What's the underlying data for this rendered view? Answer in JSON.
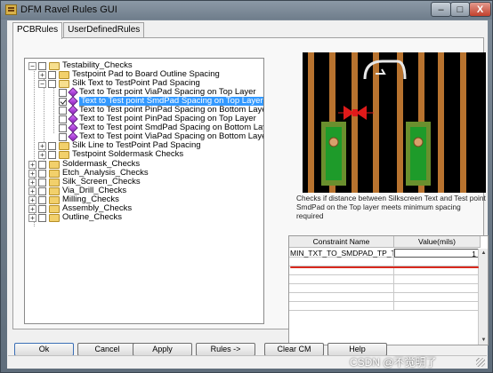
{
  "window": {
    "title": "DFM Ravel Rules GUI",
    "icon": "app-icon"
  },
  "tabs": [
    {
      "label": "PCBRules",
      "active": true
    },
    {
      "label": "UserDefinedRules",
      "active": false
    }
  ],
  "tree": {
    "testability": "Testability_Checks",
    "testpoint_pad_board": "Testpoint Pad to Board Outline Spacing",
    "silk_text_tp": "Silk Text to TestPoint Pad Spacing",
    "rules": [
      {
        "label": "Text to Test point ViaPad Spacing on Top Layer",
        "checked": false,
        "selected": false
      },
      {
        "label": "Text to Test point SmdPad Spacing on Top Layer",
        "checked": true,
        "selected": true
      },
      {
        "label": "Text to Test point PinPad Spacing on Bottom Layer",
        "checked": false,
        "selected": false
      },
      {
        "label": "Text to Test point PinPad Spacing on Top Layer",
        "checked": false,
        "selected": false
      },
      {
        "label": "Text to Test point SmdPad Spacing on Bottom Layer",
        "checked": false,
        "selected": false
      },
      {
        "label": "Text to Test point ViaPad Spacing on Bottom Layer",
        "checked": false,
        "selected": false
      }
    ],
    "silk_line_tp": "Silk Line to TestPoint Pad Spacing",
    "testpoint_soldermask": "Testpoint Soldermask Checks",
    "top_level": [
      "Soldermask_Checks",
      "Etch_Analysis_Checks",
      "Silk_Screen_Checks",
      "Via_Drill_Checks",
      "Milling_Checks",
      "Assembly_Checks",
      "Outline_Checks"
    ]
  },
  "description": "Checks if distance between Silkscreen Text and Test point SmdPad on the Top layer meets minimum spacing required",
  "constraints": {
    "headers": [
      "Constraint Name",
      "Value(mils)"
    ],
    "rows": [
      {
        "name": "MIN_TXT_TO_SMDPAD_TP_TOP_D",
        "value": "1"
      }
    ],
    "empty_rows": 8
  },
  "buttons": {
    "ok": "Ok",
    "cancel": "Cancel",
    "apply": "Apply",
    "rules": "Rules ->",
    "clear": "Clear CM",
    "help": "Help"
  },
  "window_controls": {
    "min": "–",
    "max": "□",
    "close": "X"
  },
  "watermark": "CSDN @不觉明了",
  "colors": {
    "selection": "#3399ff",
    "highlight_line": "#d9291e",
    "preview_bg": "#000000"
  }
}
